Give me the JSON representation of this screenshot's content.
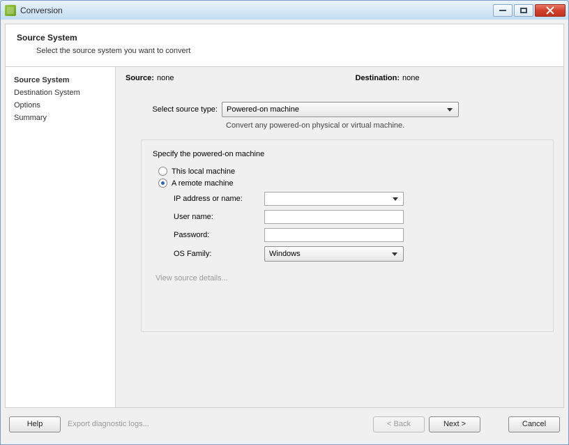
{
  "window": {
    "title": "Conversion"
  },
  "header": {
    "title": "Source System",
    "subtitle": "Select the source system you want to convert"
  },
  "nav": {
    "items": [
      "Source System",
      "Destination System",
      "Options",
      "Summary"
    ],
    "active_index": 0
  },
  "status": {
    "source_label": "Source:",
    "source_value": "none",
    "dest_label": "Destination:",
    "dest_value": "none"
  },
  "source_type": {
    "label": "Select source type:",
    "value": "Powered-on machine",
    "hint": "Convert any powered-on physical or virtual machine."
  },
  "panel": {
    "title": "Specify the powered-on machine",
    "radio_local": "This local machine",
    "radio_remote": "A remote machine",
    "selected": "remote",
    "fields": {
      "ip_label": "IP address or name:",
      "ip_value": "",
      "user_label": "User name:",
      "user_value": "",
      "pass_label": "Password:",
      "pass_value": "",
      "os_label": "OS Family:",
      "os_value": "Windows"
    },
    "view_details": "View source details..."
  },
  "footer": {
    "help": "Help",
    "export": "Export diagnostic logs...",
    "back": "< Back",
    "next": "Next >",
    "cancel": "Cancel"
  }
}
